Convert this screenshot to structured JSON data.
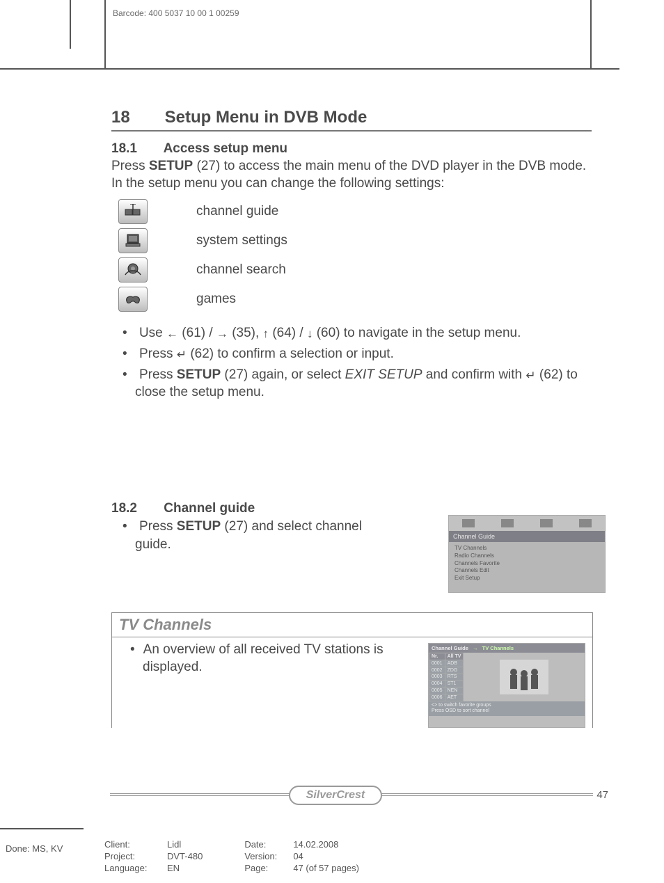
{
  "barcode": "Barcode: 400 5037 10 00 1 00259",
  "section": {
    "num": "18",
    "title": "Setup Menu in DVB Mode"
  },
  "sub1": {
    "num": "18.1",
    "title": "Access setup menu"
  },
  "intro": {
    "pre": "Press ",
    "setup": "SETUP",
    "post": " (27) to access the main menu of the DVD player in the DVB mode. In the setup menu you can change the following settings:"
  },
  "icons": {
    "guide": "channel guide",
    "system": "system settings",
    "search": "channel search",
    "games": "games"
  },
  "bullets1": {
    "b1a": "Use ",
    "b1b": " (61) / ",
    "b1c": " (35), ",
    "b1d": " (64) / ",
    "b1e": " (60) to navigate in the setup menu.",
    "b2a": "Press ",
    "b2b": " (62) to confirm a selection or input.",
    "b3a": "Press ",
    "b3setup": "SETUP",
    "b3b": " (27) again, or select ",
    "b3exit": "EXIT SETUP",
    "b3c": " and confirm with ",
    "b3d": " (62) to close the setup menu."
  },
  "sub2": {
    "num": "18.2",
    "title": "Channel guide"
  },
  "bullets2": {
    "b1a": "Press ",
    "b1setup": "SETUP",
    "b1b": " (27) and select channel guide."
  },
  "osd": {
    "header": "Channel Guide",
    "items": [
      "TV Channels",
      "Radio Channels",
      "Channels Favorite",
      "Channels Edit",
      "Exit Setup"
    ]
  },
  "tvbox": {
    "title": "TV Channels",
    "text": "An overview of all received TV stations is displayed."
  },
  "osd2": {
    "bar_left": "Channel Guide",
    "bar_right": "TV Channels",
    "cols": {
      "nr": "Nr.",
      "all": "All TV"
    },
    "rows": [
      [
        "0001",
        "ADB"
      ],
      [
        "0002",
        "ZDG"
      ],
      [
        "0003",
        "RTS"
      ],
      [
        "0004",
        "ST1"
      ],
      [
        "0005",
        "NEN"
      ],
      [
        "0006",
        "AET"
      ]
    ],
    "foot1": "<> to switch favorite groups",
    "foot2": "Press OSD to sort channel"
  },
  "brand": "SilverCrest",
  "pagenum": "47",
  "done": "Done: MS, KV",
  "meta": {
    "client_l": "Client:",
    "client_v": "Lidl",
    "project_l": "Project:",
    "project_v": "DVT-480",
    "lang_l": "Language:",
    "lang_v": "EN",
    "date_l": "Date:",
    "date_v": "14.02.2008",
    "ver_l": "Version:",
    "ver_v": "04",
    "page_l": "Page:",
    "page_v": "47 (of 57 pages)"
  }
}
